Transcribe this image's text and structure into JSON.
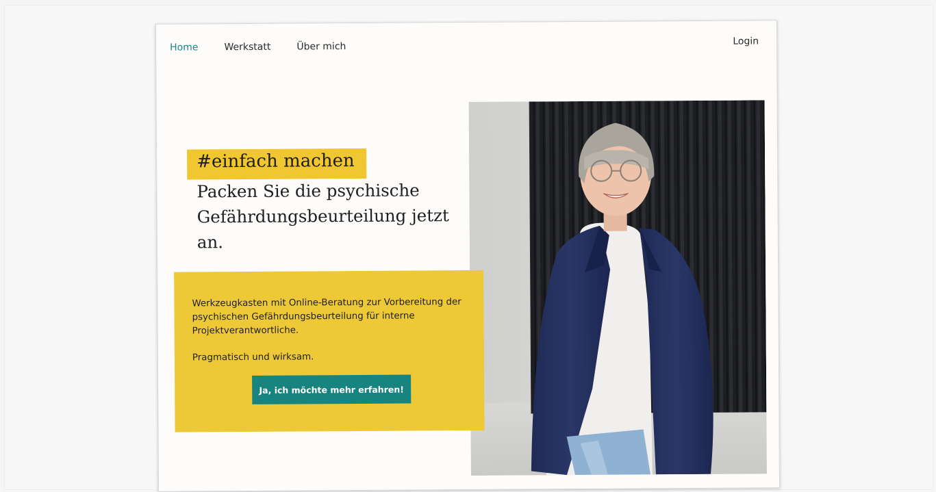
{
  "nav": {
    "items": [
      {
        "label": "Home",
        "active": true
      },
      {
        "label": "Werkstatt",
        "active": false
      },
      {
        "label": "Über mich",
        "active": false
      }
    ],
    "login_label": "Login"
  },
  "hero": {
    "hashtag": "#einfach machen",
    "headline": "Packen Sie die psychische Gefährdungsbeurteilung jetzt an.",
    "description": "Werkzeugkasten mit Online-Beratung zur Vorbereitung der psychischen Gefährdungsbeurteilung für interne Projektverantwortliche.",
    "tagline": "Pragmatisch und wirksam.",
    "cta_label": "Ja, ich möchte mehr erfahren!"
  },
  "colors": {
    "accent_teal": "#17847f",
    "accent_yellow": "#edc937",
    "background": "#fdfcfa"
  }
}
